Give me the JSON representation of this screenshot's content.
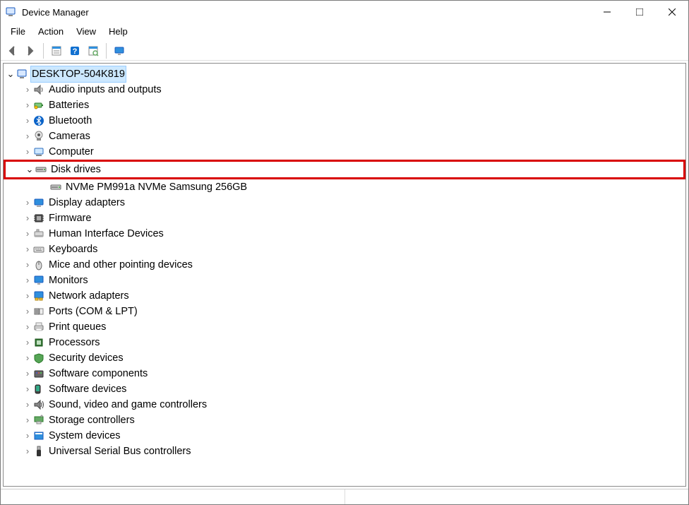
{
  "titlebar": {
    "title": "Device Manager"
  },
  "menu": {
    "file": "File",
    "action": "Action",
    "view": "View",
    "help": "Help"
  },
  "toolbar": {
    "back": "back",
    "fwd": "forward",
    "sep1": "",
    "props": "properties",
    "help": "help",
    "scan": "scan",
    "monitor": "monitor"
  },
  "root": {
    "label": "DESKTOP-504K819"
  },
  "categories": [
    {
      "id": "audio",
      "label": "Audio inputs and outputs",
      "expanded": false
    },
    {
      "id": "batt",
      "label": "Batteries",
      "expanded": false
    },
    {
      "id": "bt",
      "label": "Bluetooth",
      "expanded": false
    },
    {
      "id": "cam",
      "label": "Cameras",
      "expanded": false
    },
    {
      "id": "comp",
      "label": "Computer",
      "expanded": false
    },
    {
      "id": "disk",
      "label": "Disk drives",
      "expanded": true,
      "children": [
        {
          "id": "nvme",
          "label": "NVMe PM991a NVMe Samsung 256GB"
        }
      ]
    },
    {
      "id": "disp",
      "label": "Display adapters",
      "expanded": false
    },
    {
      "id": "fw",
      "label": "Firmware",
      "expanded": false
    },
    {
      "id": "hid",
      "label": "Human Interface Devices",
      "expanded": false
    },
    {
      "id": "kbd",
      "label": "Keyboards",
      "expanded": false
    },
    {
      "id": "mouse",
      "label": "Mice and other pointing devices",
      "expanded": false
    },
    {
      "id": "mon",
      "label": "Monitors",
      "expanded": false
    },
    {
      "id": "net",
      "label": "Network adapters",
      "expanded": false
    },
    {
      "id": "ports",
      "label": "Ports (COM & LPT)",
      "expanded": false
    },
    {
      "id": "printq",
      "label": "Print queues",
      "expanded": false
    },
    {
      "id": "cpu",
      "label": "Processors",
      "expanded": false
    },
    {
      "id": "sec",
      "label": "Security devices",
      "expanded": false
    },
    {
      "id": "swc",
      "label": "Software components",
      "expanded": false
    },
    {
      "id": "swd",
      "label": "Software devices",
      "expanded": false
    },
    {
      "id": "snd",
      "label": "Sound, video and game controllers",
      "expanded": false
    },
    {
      "id": "stor",
      "label": "Storage controllers",
      "expanded": false
    },
    {
      "id": "sys",
      "label": "System devices",
      "expanded": false
    },
    {
      "id": "usb",
      "label": "Universal Serial Bus controllers",
      "expanded": false
    }
  ],
  "highlightId": "disk",
  "colors": {
    "highlight": "#cce8ff",
    "highlightBorder": "#99cdff",
    "red": "#d80000"
  }
}
